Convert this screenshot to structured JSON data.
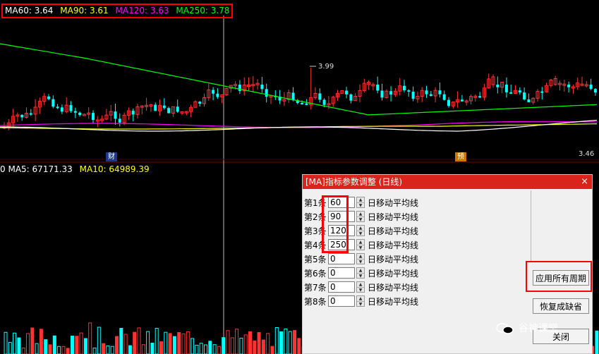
{
  "ma_legend": [
    {
      "name": "MA60",
      "value": "3.64",
      "color": "#ffffff"
    },
    {
      "name": "MA90",
      "value": "3.61",
      "color": "#ffff00"
    },
    {
      "name": "MA120",
      "value": "3.63",
      "color": "#ff00ff"
    },
    {
      "name": "MA250",
      "value": "3.78",
      "color": "#00ff00"
    }
  ],
  "volume_legend": {
    "prefix": "0",
    "ma5_label": "MA5:",
    "ma5_value": "67171.33",
    "ma10_label": "MA10:",
    "ma10_value": "64989.39"
  },
  "annotations": {
    "high_price": "3.99",
    "low_price": "3.46"
  },
  "markers": {
    "fin": "财",
    "pre": "预"
  },
  "dialog": {
    "title": "[MA]指标参数调整 (日线)",
    "close": "×",
    "rows": [
      {
        "label": "第1条",
        "value": "60",
        "suffix": "日移动平均线"
      },
      {
        "label": "第2条",
        "value": "90",
        "suffix": "日移动平均线"
      },
      {
        "label": "第3条",
        "value": "120",
        "suffix": "日移动平均线"
      },
      {
        "label": "第4条",
        "value": "250",
        "suffix": "日移动平均线"
      },
      {
        "label": "第5条",
        "value": "0",
        "suffix": "日移动平均线"
      },
      {
        "label": "第6条",
        "value": "0",
        "suffix": "日移动平均线"
      },
      {
        "label": "第7条",
        "value": "0",
        "suffix": "日移动平均线"
      },
      {
        "label": "第8条",
        "value": "0",
        "suffix": "日移动平均线"
      }
    ],
    "buttons": {
      "apply_all": "应用所有周期",
      "restore_default": "恢复成缺省",
      "close": "关闭"
    }
  },
  "watermark": "谷神课堂",
  "colors": {
    "up": "#ff3232",
    "down": "#00ffff",
    "ma60": "#ffffff",
    "ma90": "#ffff00",
    "ma120": "#ff00ff",
    "ma250": "#00ff00",
    "dialog_title": "#d8241a"
  }
}
